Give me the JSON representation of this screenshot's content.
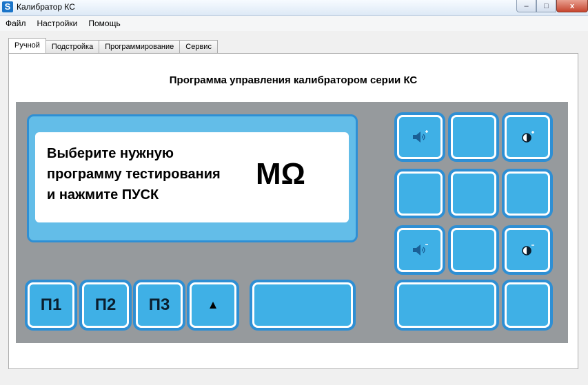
{
  "window": {
    "title": "Калибратор КС",
    "app_icon": "S",
    "controls": {
      "minimize": "–",
      "maximize": "□",
      "close": "x"
    }
  },
  "menu": [
    "Файл",
    "Настройки",
    "Помощь"
  ],
  "tabs": [
    "Ручной",
    "Подстройка",
    "Программирование",
    "Сервис"
  ],
  "active_tab": "Ручной",
  "panel": {
    "heading": "Программа управления калибратором серии КС"
  },
  "display": {
    "lines": [
      "Выберите нужную",
      "программу тестирования",
      "и нажмите ПУСК"
    ],
    "unit": "МΩ"
  },
  "keys": {
    "p1": "П1",
    "p2": "П2",
    "p3": "П3",
    "up": "▲"
  },
  "icons": {
    "volume_up": "speaker-plus-icon",
    "volume_down": "speaker-minus-icon",
    "contrast_up": "contrast-plus-icon",
    "contrast_down": "contrast-minus-icon"
  },
  "colors": {
    "device_body": "#969a9d",
    "key_fill": "#3fb0e6",
    "key_border": "#2e8fd4",
    "lcd_frame": "#63bde8"
  }
}
